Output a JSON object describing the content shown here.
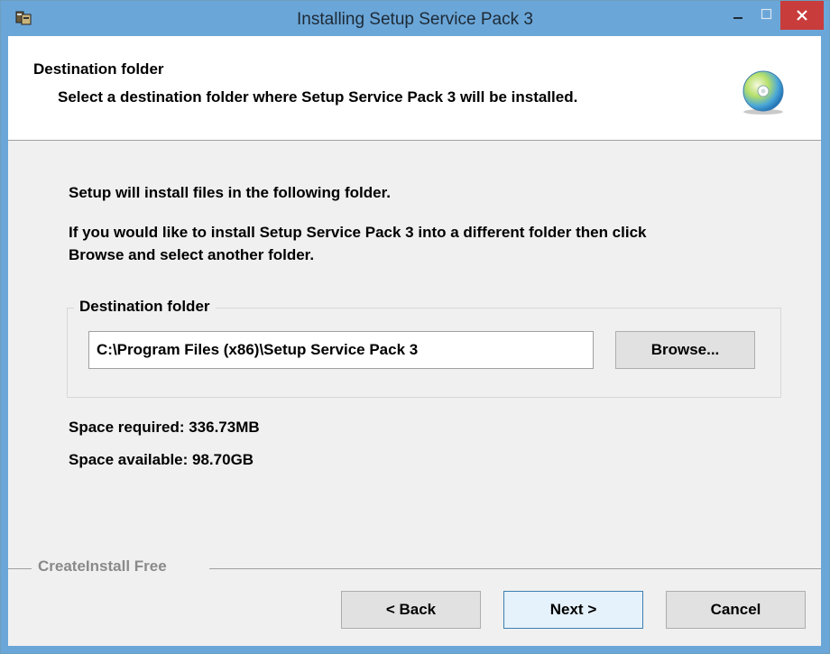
{
  "window": {
    "title": "Installing Setup Service Pack 3"
  },
  "header": {
    "title": "Destination folder",
    "subtitle": "Select a destination folder where Setup Service Pack 3 will be installed."
  },
  "body": {
    "line1": "Setup will install files in the following folder.",
    "line2a": "If you would like to install Setup Service Pack 3 into a different folder then click",
    "line2b": "Browse and select another folder."
  },
  "destination": {
    "group_label": "Destination folder",
    "path_value": "C:\\Program Files (x86)\\Setup Service Pack 3",
    "browse_label": "Browse..."
  },
  "space": {
    "required": "Space required: 336.73MB",
    "available": "Space available: 98.70GB"
  },
  "footer": {
    "brand": "CreateInstall Free",
    "back_label": "< Back",
    "next_label": "Next >",
    "cancel_label": "Cancel"
  },
  "colors": {
    "titlebar": "#6ba6d8",
    "close_button": "#c83c3b",
    "dialog_bg": "#f0f0f0",
    "default_button_border": "#3c7fb1"
  },
  "icons": [
    "installer-app-icon",
    "minimize-icon",
    "maximize-icon",
    "close-icon",
    "cd-disc-icon"
  ]
}
